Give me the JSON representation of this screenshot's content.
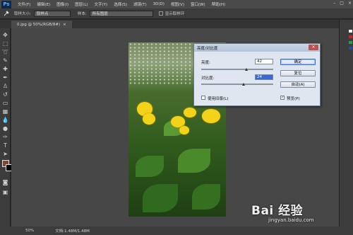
{
  "menubar": {
    "logo": "Ps",
    "items": [
      "文件(F)",
      "编辑(E)",
      "图像(I)",
      "图层(L)",
      "文字(Y)",
      "选择(S)",
      "滤镜(T)",
      "3D(D)",
      "视图(V)",
      "窗口(W)",
      "帮助(H)"
    ],
    "controls": [
      "–",
      "□",
      "×"
    ]
  },
  "optbar": {
    "tool_icon": "eyedropper-icon",
    "sample_size_label": "取样大小:",
    "sample_size_value": "取样点",
    "sample_label": "样本:",
    "sample_value": "所有图层",
    "show_ring_label": "显示取样环"
  },
  "tab": {
    "title": "0.jpg @ 50%(RGB/8#)",
    "close": "×"
  },
  "toolbar": {
    "tools": [
      "move-icon",
      "marquee-icon",
      "lasso-icon",
      "eyedropper-icon",
      "heal-icon",
      "brush-icon",
      "stamp-icon",
      "history-brush-icon",
      "eraser-icon",
      "gradient-icon",
      "blur-icon",
      "dodge-icon",
      "pen-icon",
      "type-icon",
      "path-select-icon",
      "shape-icon",
      "hand-icon",
      "zoom-icon"
    ],
    "colors": {
      "foreground": "#7a4b34",
      "background": "#000000"
    }
  },
  "statusbar": {
    "zoom": "50%",
    "doc_size": "文档:1.48M/1.48M"
  },
  "dialog": {
    "title": "亮度/对比度",
    "close": "×",
    "brightness_label": "亮度:",
    "brightness_value": "42",
    "contrast_label": "对比度:",
    "contrast_value": "24",
    "use_legacy_label": "使用旧版(L)",
    "use_legacy_checked": false,
    "preview_label": "预览(P)",
    "preview_checked": true,
    "ok_label": "确定",
    "reset_label": "复位",
    "auto_label": "自动(A)"
  },
  "watermark": {
    "main": "Bai 经验",
    "url": "jingyan.baidu.com"
  }
}
